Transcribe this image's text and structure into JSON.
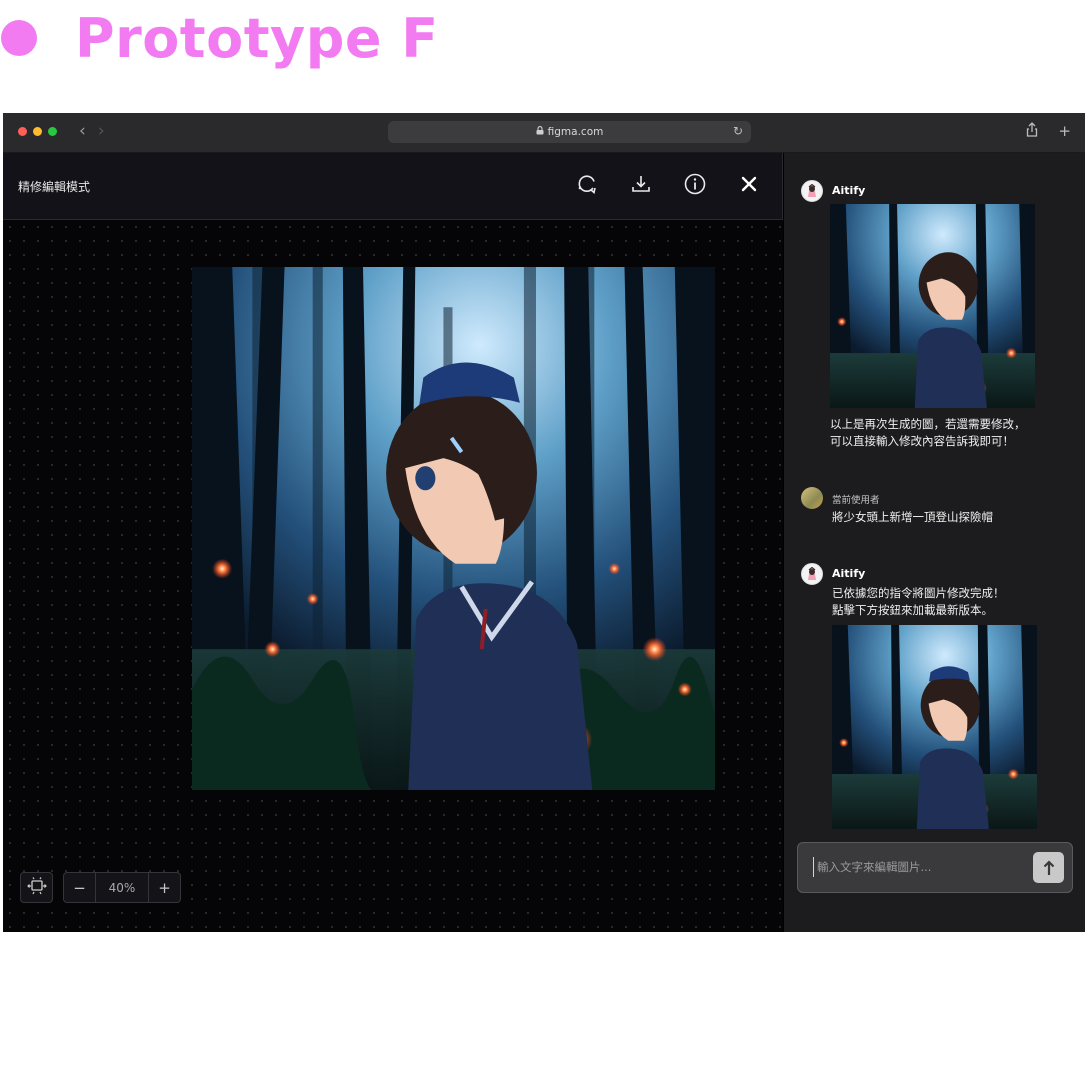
{
  "heading": {
    "title": "Prototype F",
    "dot_color": "#f27bf2"
  },
  "browser": {
    "url": "figma.com",
    "lock_icon": "lock-icon",
    "back_glyph": "‹",
    "forward_glyph": "›",
    "reload_glyph": "↻",
    "share_glyph": "⇪",
    "new_tab_glyph": "+"
  },
  "editor": {
    "mode_label": "精修編輯模式",
    "tools": [
      "regenerate-icon",
      "download-icon",
      "info-icon",
      "close-icon"
    ],
    "zoom": {
      "minus": "−",
      "value": "40%",
      "plus": "+"
    }
  },
  "chat": {
    "messages": [
      {
        "sender": "Aitify",
        "text_line1": "以上是再次生成的圖，若還需要修改，",
        "text_line2": "可以直接輸入修改內容告訴我即可！"
      },
      {
        "sender": "當前使用者",
        "text": "將少女頭上新增一頂登山探險帽"
      },
      {
        "sender": "Aitify",
        "text_line1": "已依據您的指令將圖片修改完成！",
        "text_line2": "點擊下方按鈕來加載最新版本。"
      }
    ],
    "input_placeholder": "輸入文字來編輯圖片...",
    "send_glyph": "⭡"
  },
  "colors": {
    "accent": "#f27bf2",
    "editor_bg": "#0a0a0c",
    "chat_bg": "#1c1c1e"
  }
}
